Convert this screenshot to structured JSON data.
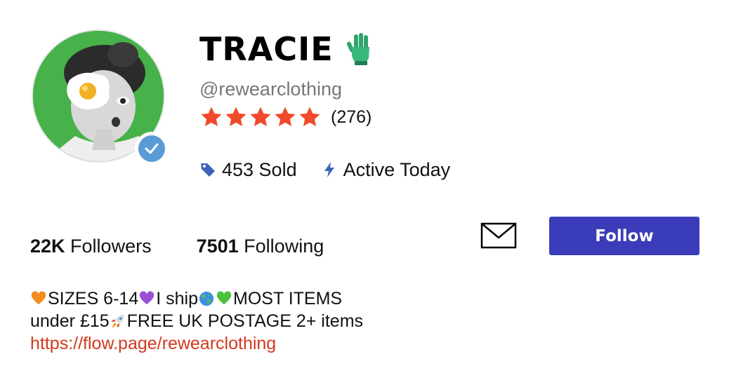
{
  "profile": {
    "name": "TRACIE",
    "handle": "@rewearclothing",
    "rating_count": "(276)",
    "rating": {
      "value": 5,
      "max": 5
    },
    "sold": "453 Sold",
    "active": "Active Today",
    "followers_count": "22K",
    "followers_label": "Followers",
    "following_count": "7501",
    "following_label": "Following",
    "follow_label": "Follow",
    "bio": {
      "segments_line1": [
        "SIZES 6-14 ",
        "I ship ",
        " ",
        "MOST ITEMS"
      ],
      "segments_line2": [
        "under £15 ",
        "FREE UK POSTAGE 2+ items"
      ],
      "link": "https://flow.page/rewearclothing"
    }
  },
  "icons": {
    "glove": "green-glove-icon",
    "verified": "verified-check-icon",
    "tag": "price-tag-icon",
    "bolt": "lightning-bolt-icon",
    "message": "envelope-icon",
    "orange_heart": "orange-heart-icon",
    "purple_heart": "purple-heart-icon",
    "globe": "globe-icon",
    "green_heart": "green-heart-icon",
    "rocket": "rocket-icon"
  },
  "colors": {
    "star": "#f04a2c",
    "accent_blue": "#3b3cb9",
    "link": "#d2391e",
    "verified": "#5a9bd6",
    "avatar_bg": "#47b14a",
    "icon_blue": "#3d63b8"
  }
}
